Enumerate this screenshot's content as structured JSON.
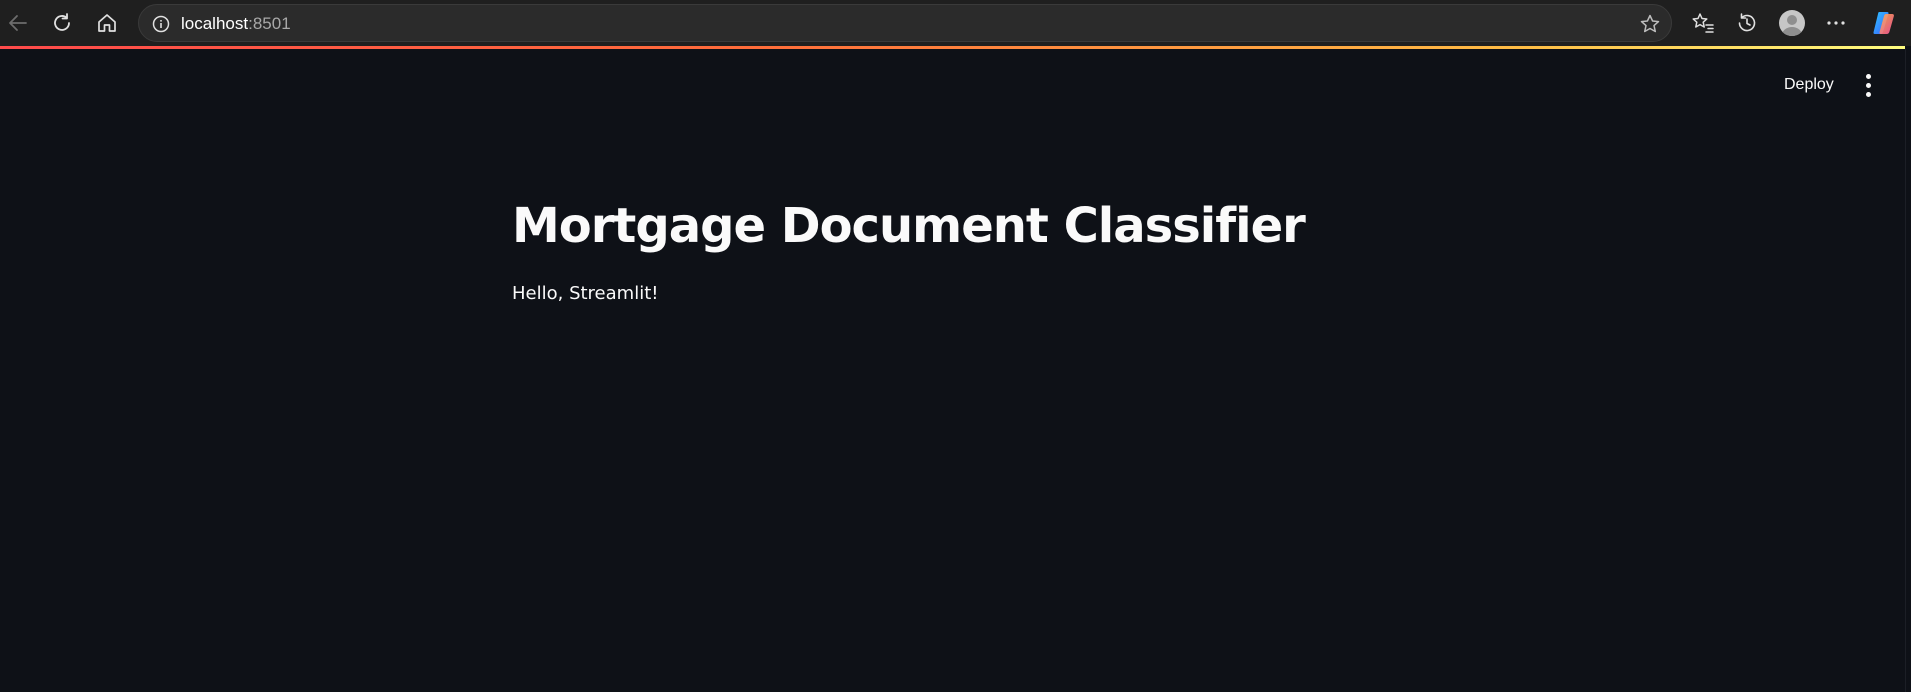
{
  "browser": {
    "url_host": "localhost",
    "url_port": ":8501",
    "icons": {
      "back": "arrow-left-icon",
      "reload": "reload-icon",
      "home": "home-icon",
      "info": "info-icon",
      "favorite": "star-icon",
      "favorites_list": "favorites-icon",
      "history": "history-icon",
      "profile": "profile-avatar",
      "more": "more-dots-icon",
      "copilot": "copilot-icon"
    }
  },
  "header": {
    "deploy_label": "Deploy"
  },
  "main": {
    "title": "Mortgage Document Classifier",
    "body_text": "Hello, Streamlit!"
  },
  "colors": {
    "background": "#0e1117",
    "text": "#fafafa",
    "accent": "#ff4b4b"
  }
}
